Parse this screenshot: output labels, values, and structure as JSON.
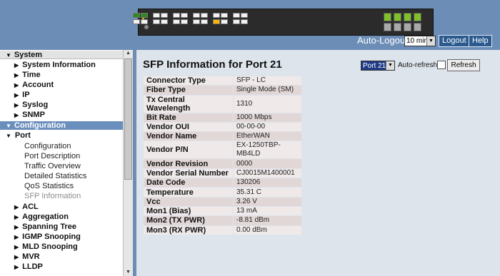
{
  "header": {
    "auto_logout_label": "Auto-Logout",
    "auto_logout_value": "10 min",
    "logout_label": "Logout",
    "help_label": "Help"
  },
  "sidebar": {
    "system_header": "System",
    "system_items": [
      "System Information",
      "Time",
      "Account",
      "IP",
      "Syslog",
      "SNMP"
    ],
    "configuration_header": "Configuration",
    "port_label": "Port",
    "port_subitems": [
      "Configuration",
      "Port Description",
      "Traffic Overview",
      "Detailed Statistics",
      "QoS Statistics",
      "SFP Information"
    ],
    "config_items": [
      "ACL",
      "Aggregation",
      "Spanning Tree",
      "IGMP Snooping",
      "MLD Snooping",
      "MVR",
      "LLDP"
    ]
  },
  "content": {
    "title": "SFP Information for  Port 21",
    "port_select_value": "Port 21",
    "autorefresh_label": "Auto-refresh",
    "refresh_label": "Refresh",
    "rows": [
      {
        "key": "Connector Type",
        "value": "SFP - LC"
      },
      {
        "key": "Fiber Type",
        "value": "Single Mode (SM)"
      },
      {
        "key": "Tx Central Wavelength",
        "value": "1310"
      },
      {
        "key": "Bit Rate",
        "value": "1000 Mbps"
      },
      {
        "key": "Vendor OUI",
        "value": "00-00-00"
      },
      {
        "key": "Vendor Name",
        "value": "EtherWAN"
      },
      {
        "key": "Vendor P/N",
        "value": "EX-1250TBP-MB4LD"
      },
      {
        "key": "Vendor Revision",
        "value": "0000"
      },
      {
        "key": "Vendor Serial Number",
        "value": "CJ0015M1400001"
      },
      {
        "key": "Date Code",
        "value": "130206"
      },
      {
        "key": "Temperature",
        "value": "35.31 C"
      },
      {
        "key": "Vcc",
        "value": "3.26 V"
      },
      {
        "key": "Mon1 (Bias)",
        "value": "13 mA"
      },
      {
        "key": "Mon2 (TX PWR)",
        "value": "-8.81 dBm"
      },
      {
        "key": "Mon3 (RX PWR)",
        "value": "0.00 dBm"
      }
    ]
  },
  "icons": {
    "collapse": "triangle-down-icon",
    "expand": "triangle-right-icon",
    "select_arrow": "chevron-down-icon"
  },
  "colors": {
    "background": "#6c8db6",
    "config_header": "#6b8fbd",
    "selected_port": "#ffb400",
    "link_port": "#2d8a1f",
    "table_odd": "#efe9e9",
    "table_even": "#e2d7d7"
  }
}
